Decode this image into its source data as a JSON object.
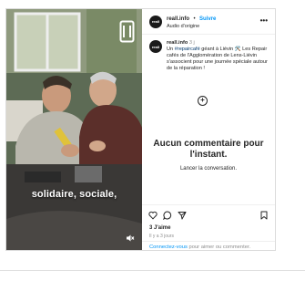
{
  "account": {
    "username": "reall.info",
    "separator": "•",
    "follow_label": "Suivre",
    "audio_label": "Audio d'origine",
    "avatar_text": "reall"
  },
  "post": {
    "username": "reall.info",
    "time": "3 j",
    "text_prefix": "Un ",
    "hashtag": "#repaircafé",
    "text_rest": " géant à Liévin 🛠️ Les Repair cafés de l'Agglomération de Lens-Liévin s'associent pour une journée spéciale autour de la réparation !"
  },
  "video": {
    "caption": "solidaire, sociale,"
  },
  "comments": {
    "empty_title": "Aucun commentaire pour l'instant.",
    "empty_subtitle": "Lancer la conversation."
  },
  "stats": {
    "likes": "3 J'aime",
    "time_ago": "Il y a 3 jours"
  },
  "login": {
    "link_text": "Connectez-vous",
    "rest_text": " pour aimer ou commenter."
  },
  "icons": {
    "more": "more-horizontal-icon",
    "like": "heart-icon",
    "comment": "comment-icon",
    "share": "send-icon",
    "save": "bookmark-icon",
    "add": "plus-circle-icon",
    "reel": "reel-icon",
    "mute": "speaker-muted-icon"
  },
  "colors": {
    "link_blue": "#0095f6",
    "hashtag": "#00376b",
    "muted_text": "#8e8e8e",
    "border": "#dbdbdb"
  }
}
